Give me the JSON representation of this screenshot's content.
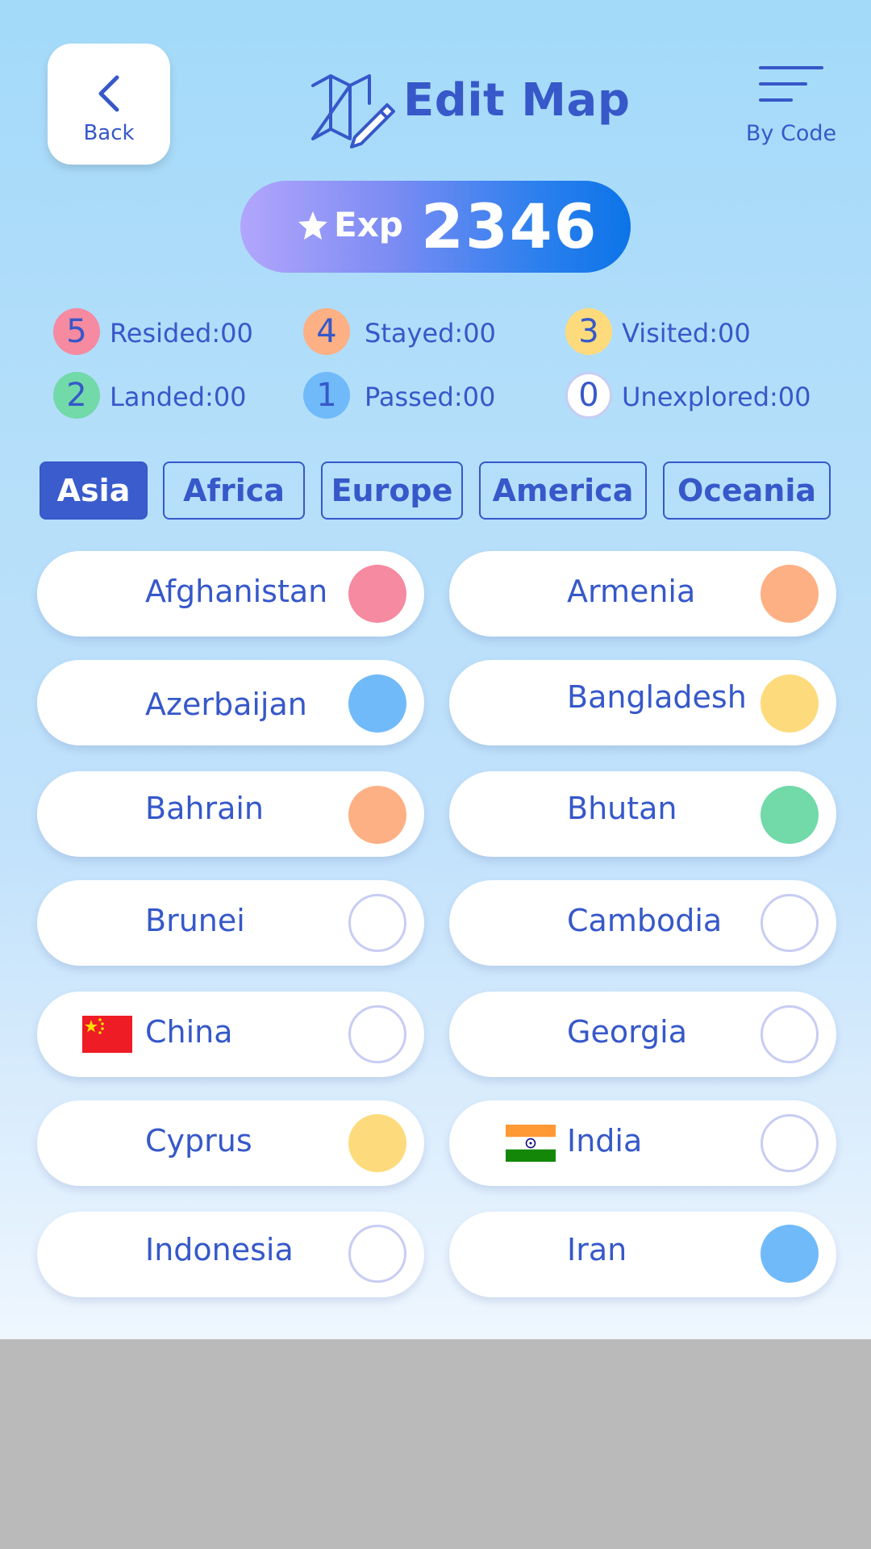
{
  "header": {
    "back_label": "Back",
    "title": "Edit Map",
    "menu_label": "By Code"
  },
  "exp": {
    "label": "Exp",
    "value": "2346"
  },
  "legend": [
    {
      "badge": "5",
      "label": "Resided:",
      "count": "00",
      "color": "#f58aa0"
    },
    {
      "badge": "4",
      "label": "Stayed:",
      "count": "00",
      "color": "#fdb084"
    },
    {
      "badge": "3",
      "label": "Visited:",
      "count": "00",
      "color": "#fddb7c"
    },
    {
      "badge": "2",
      "label": "Landed:",
      "count": "00",
      "color": "#72d9a9"
    },
    {
      "badge": "1",
      "label": "Passed:",
      "count": "00",
      "color": "#70bafa"
    },
    {
      "badge": "0",
      "label": "Unexplored:",
      "count": "00",
      "color": "#ffffff"
    }
  ],
  "tabs": [
    "Asia",
    "Africa",
    "Europe",
    "America",
    "Oceania"
  ],
  "active_tab": "Asia",
  "countries": [
    {
      "name": "Afghanistan",
      "level": 5,
      "flag": ""
    },
    {
      "name": "Armenia",
      "level": 4,
      "flag": ""
    },
    {
      "name": "Azerbaijan",
      "level": 1,
      "flag": ""
    },
    {
      "name": "Bangladesh",
      "level": 3,
      "flag": ""
    },
    {
      "name": "Bahrain",
      "level": 4,
      "flag": ""
    },
    {
      "name": "Bhutan",
      "level": 2,
      "flag": ""
    },
    {
      "name": "Brunei",
      "level": 0,
      "flag": ""
    },
    {
      "name": "Cambodia",
      "level": 0,
      "flag": ""
    },
    {
      "name": "China",
      "level": 0,
      "flag": "china-flag-icon"
    },
    {
      "name": "Georgia",
      "level": 0,
      "flag": ""
    },
    {
      "name": "Cyprus",
      "level": 3,
      "flag": ""
    },
    {
      "name": "India",
      "level": 0,
      "flag": "india-flag-icon"
    },
    {
      "name": "Indonesia",
      "level": 0,
      "flag": ""
    },
    {
      "name": "Iran",
      "level": 1,
      "flag": ""
    }
  ],
  "colors": {
    "accent": "#3658c9",
    "level_5": "#f58aa0",
    "level_4": "#fdb084",
    "level_3": "#fddb7c",
    "level_2": "#72d9a9",
    "level_1": "#70bafa"
  }
}
